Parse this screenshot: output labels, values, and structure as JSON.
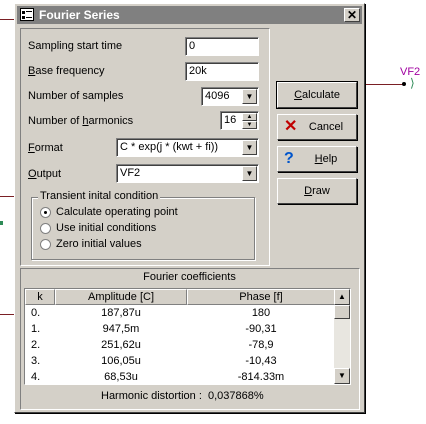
{
  "background": {
    "net_label": "VF2"
  },
  "dialog": {
    "title": "Fourier Series",
    "close_glyph": "✕",
    "fields": {
      "sampling_start_time": {
        "label": "Sampling start time",
        "value": "0"
      },
      "base_frequency": {
        "label_prefix": "B",
        "label_rest": "ase frequency",
        "value": "20k"
      },
      "number_of_samples": {
        "label": "Number of samples",
        "value": "4096"
      },
      "number_of_harmonics": {
        "label_prefix": "Number of ",
        "label_hot": "h",
        "label_rest": "armonics",
        "value": "16"
      },
      "format": {
        "label_prefix": "F",
        "label_rest": "ormat",
        "value": "C * exp(j * (kwt + fi))"
      },
      "output": {
        "label_prefix": "O",
        "label_rest": "utput",
        "value": "VF2"
      }
    },
    "transient": {
      "title": "Transient inital condition",
      "options": [
        {
          "label": "Calculate operating point",
          "checked": true
        },
        {
          "label": "Use initial conditions",
          "checked": false
        },
        {
          "label": "Zero initial values",
          "checked": false
        }
      ]
    },
    "buttons": {
      "calculate": {
        "hot": "C",
        "rest": "alculate"
      },
      "cancel": "Cancel",
      "help": {
        "hot": "H",
        "rest": "elp"
      },
      "draw": {
        "hot": "D",
        "rest": "raw"
      }
    },
    "coefficients": {
      "title": "Fourier coefficients",
      "columns": [
        "k",
        "Amplitude [C]",
        "Phase [f]"
      ],
      "rows": [
        {
          "k": "0.",
          "amplitude": "187,87u",
          "phase": "180"
        },
        {
          "k": "1.",
          "amplitude": "947,5m",
          "phase": "-90,31"
        },
        {
          "k": "2.",
          "amplitude": "251,62u",
          "phase": "-78,9"
        },
        {
          "k": "3.",
          "amplitude": "106,05u",
          "phase": "-10,43"
        },
        {
          "k": "4.",
          "amplitude": "68,53u",
          "phase": "-814.33m"
        }
      ],
      "harmonic_distortion_label": "Harmonic distortion :",
      "harmonic_distortion_value": "0,037868%"
    },
    "icons": {
      "title": "fourier-app-icon",
      "cancel": "red-x-icon",
      "help": "question-mark-icon"
    },
    "colors": {
      "titlebar": "#808080",
      "face": "#d4d0c8",
      "cancel_x": "#c00000",
      "help_q": "#0055cc",
      "net_label": "#a000a0"
    }
  }
}
